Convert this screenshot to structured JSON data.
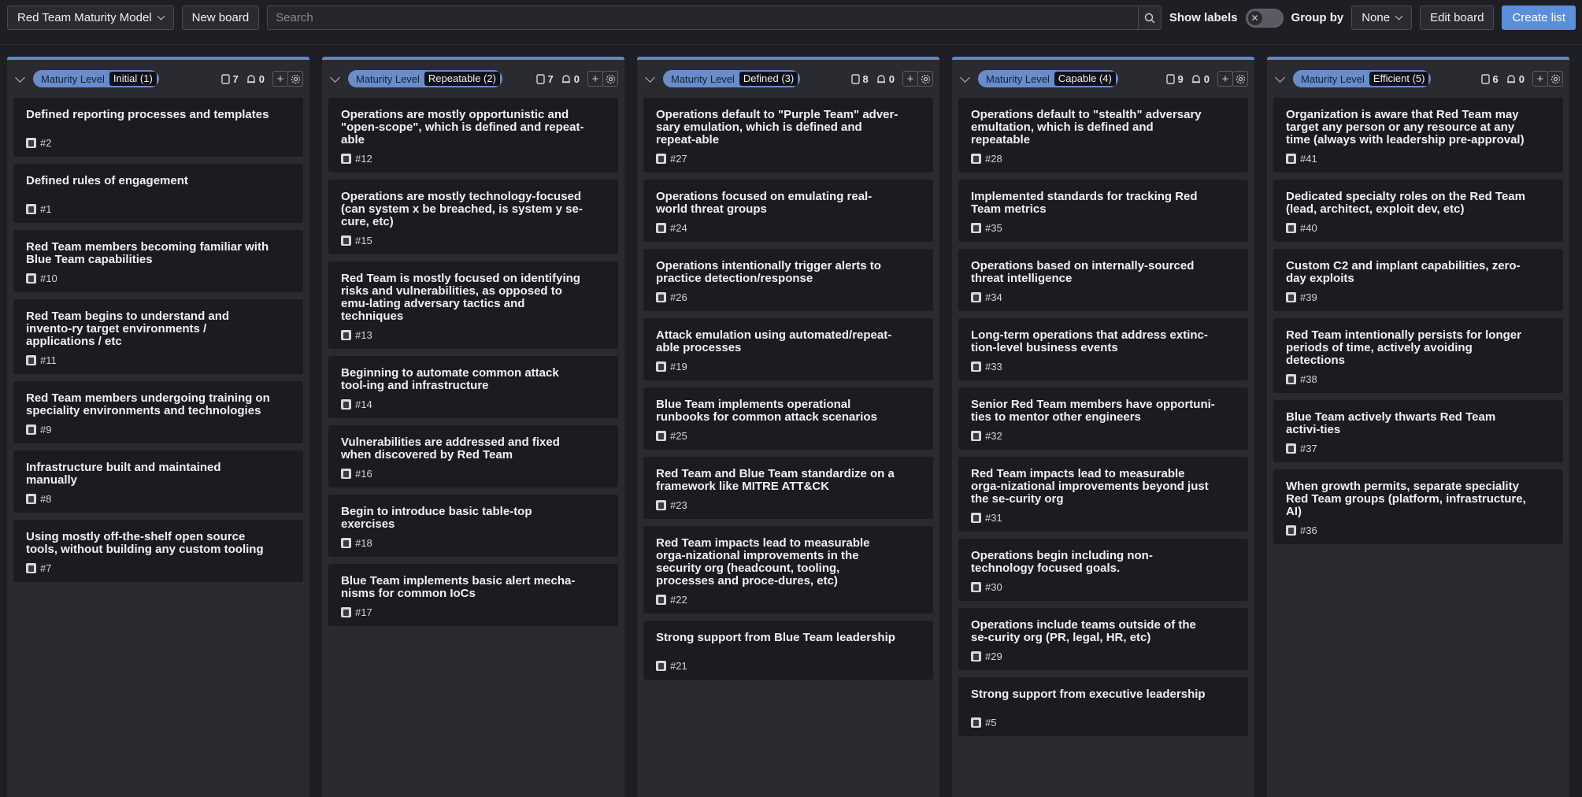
{
  "toolbar": {
    "board_select": "Red Team Maturity Model",
    "new_board": "New board",
    "search_placeholder": "Search",
    "show_labels": "Show labels",
    "group_by_label": "Group by",
    "group_by_value": "None",
    "edit_board": "Edit board",
    "create_list": "Create list"
  },
  "columns": [
    {
      "tag_key": "Maturity Level",
      "tag_value": "Initial (1)",
      "stories": "7",
      "points": "0",
      "cards": [
        {
          "title": "Defined reporting processes and templates",
          "id": "#2"
        },
        {
          "title": "Defined rules of engagement",
          "id": "#1"
        },
        {
          "title": "Red Team members becoming familiar with Blue Team capabilities",
          "id": "#10"
        },
        {
          "title": "Red Team begins to understand and invento-ry target environments / applications / etc",
          "id": "#11"
        },
        {
          "title": "Red Team members undergoing training on speciality environments and technologies",
          "id": "#9"
        },
        {
          "title": "Infrastructure built and maintained manually",
          "id": "#8"
        },
        {
          "title": "Using mostly off-the-shelf open source tools, without building any custom tooling",
          "id": "#7"
        }
      ]
    },
    {
      "tag_key": "Maturity Level",
      "tag_value": "Repeatable (2)",
      "stories": "7",
      "points": "0",
      "cards": [
        {
          "title": "Operations are mostly opportunistic and \"open-scope\", which is defined and repeat-able",
          "id": "#12"
        },
        {
          "title": "Operations are mostly technology-focused (can system x be breached, is system y se-cure, etc)",
          "id": "#15"
        },
        {
          "title": "Red Team is mostly focused on identifying risks and vulnerabilities, as opposed to emu-lating adversary tactics and techniques",
          "id": "#13"
        },
        {
          "title": "Beginning to automate common attack tool-ing and infrastructure",
          "id": "#14"
        },
        {
          "title": "Vulnerabilities are addressed and fixed when discovered by Red Team",
          "id": "#16"
        },
        {
          "title": "Begin to introduce basic table-top exercises",
          "id": "#18"
        },
        {
          "title": "Blue Team implements basic alert mecha-nisms for common IoCs",
          "id": "#17"
        }
      ]
    },
    {
      "tag_key": "Maturity Level",
      "tag_value": "Defined (3)",
      "stories": "8",
      "points": "0",
      "cards": [
        {
          "title": "Operations default to \"Purple Team\" adver-sary emulation, which is defined and repeat-able",
          "id": "#27"
        },
        {
          "title": "Operations focused on emulating real-world threat groups",
          "id": "#24"
        },
        {
          "title": "Operations intentionally trigger alerts to practice detection/response",
          "id": "#26"
        },
        {
          "title": "Attack emulation using automated/repeat-able processes",
          "id": "#19"
        },
        {
          "title": "Blue Team implements operational runbooks for common attack scenarios",
          "id": "#25"
        },
        {
          "title": "Red Team and Blue Team standardize on a framework like MITRE ATT&CK",
          "id": "#23"
        },
        {
          "title": "Red Team impacts lead to measurable orga-nizational improvements in the security org (headcount, tooling, processes and proce-dures, etc)",
          "id": "#22"
        },
        {
          "title": "Strong support from Blue Team leadership",
          "id": "#21"
        }
      ]
    },
    {
      "tag_key": "Maturity Level",
      "tag_value": "Capable (4)",
      "stories": "9",
      "points": "0",
      "cards": [
        {
          "title": "Operations default to \"stealth\" adversary emultation, which is defined and repeatable",
          "id": "#28"
        },
        {
          "title": "Implemented standards for tracking Red Team metrics",
          "id": "#35"
        },
        {
          "title": "Operations based on internally-sourced threat intelligence",
          "id": "#34"
        },
        {
          "title": "Long-term operations that address extinc-tion-level business events",
          "id": "#33"
        },
        {
          "title": "Senior Red Team members have opportuni-ties to mentor other engineers",
          "id": "#32"
        },
        {
          "title": "Red Team impacts lead to measurable orga-nizational improvements beyond just the se-curity org",
          "id": "#31"
        },
        {
          "title": "Operations begin including non-technology focused goals.",
          "id": "#30"
        },
        {
          "title": "Operations include teams outside of the se-curity org (PR, legal, HR, etc)",
          "id": "#29"
        },
        {
          "title": "Strong support from executive leadership",
          "id": "#5"
        }
      ]
    },
    {
      "tag_key": "Maturity Level",
      "tag_value": "Efficient (5)",
      "stories": "6",
      "points": "0",
      "cards": [
        {
          "title": "Organization is aware that Red Team may target any person or any resource at any time (always with leadership pre-approval)",
          "id": "#41"
        },
        {
          "title": "Dedicated specialty roles on the Red Team (lead, architect, exploit dev, etc)",
          "id": "#40"
        },
        {
          "title": "Custom C2 and implant capabilities, zero-day exploits",
          "id": "#39"
        },
        {
          "title": "Red Team intentionally persists for longer periods of time, actively avoiding detections",
          "id": "#38"
        },
        {
          "title": "Blue Team actively thwarts Red Team activi-ties",
          "id": "#37"
        },
        {
          "title": "When growth permits, separate speciality Red Team groups (platform, infrastructure, AI)",
          "id": "#36"
        }
      ]
    }
  ]
}
